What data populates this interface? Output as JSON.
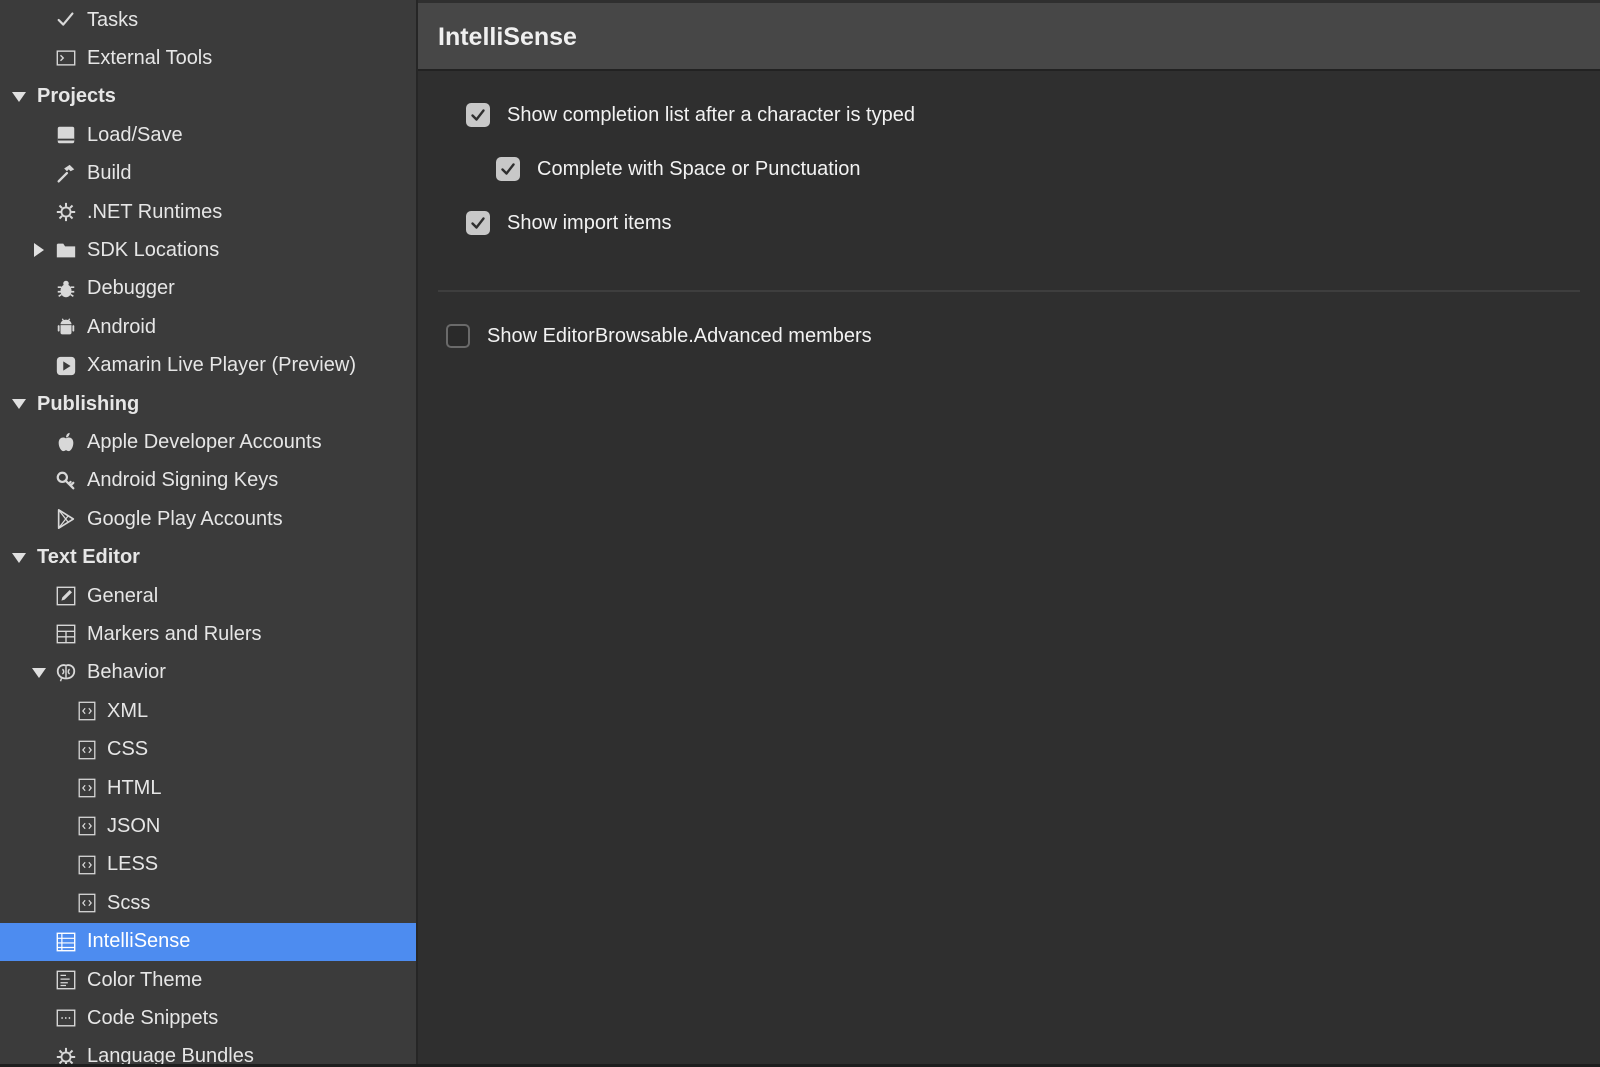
{
  "sidebar": {
    "items": [
      {
        "label": "Tasks",
        "icon": "checkmark-icon",
        "kind": "item"
      },
      {
        "label": "External Tools",
        "icon": "terminal-icon",
        "kind": "item"
      },
      {
        "label": "Projects",
        "kind": "category",
        "expanded": true
      },
      {
        "label": "Load/Save",
        "icon": "disk-icon",
        "kind": "item"
      },
      {
        "label": "Build",
        "icon": "hammer-icon",
        "kind": "item"
      },
      {
        "label": ".NET Runtimes",
        "icon": "gear-icon",
        "kind": "item"
      },
      {
        "label": "SDK Locations",
        "icon": "folder-icon",
        "kind": "item",
        "expandable": true,
        "expanded": false
      },
      {
        "label": "Debugger",
        "icon": "bug-icon",
        "kind": "item"
      },
      {
        "label": "Android",
        "icon": "android-icon",
        "kind": "item"
      },
      {
        "label": "Xamarin Live Player (Preview)",
        "icon": "play-icon",
        "kind": "item"
      },
      {
        "label": "Publishing",
        "kind": "category",
        "expanded": true
      },
      {
        "label": "Apple Developer Accounts",
        "icon": "apple-icon",
        "kind": "item"
      },
      {
        "label": "Android Signing Keys",
        "icon": "key-icon",
        "kind": "item"
      },
      {
        "label": "Google Play Accounts",
        "icon": "google-play-icon",
        "kind": "item"
      },
      {
        "label": "Text Editor",
        "kind": "category",
        "expanded": true
      },
      {
        "label": "General",
        "icon": "edit-icon",
        "kind": "item"
      },
      {
        "label": "Markers and Rulers",
        "icon": "ruler-grid-icon",
        "kind": "item"
      },
      {
        "label": "Behavior",
        "icon": "brain-icon",
        "kind": "item",
        "expandable": true,
        "expanded": true
      },
      {
        "label": "XML",
        "icon": "code-file-icon",
        "kind": "subitem"
      },
      {
        "label": "CSS",
        "icon": "code-file-icon",
        "kind": "subitem"
      },
      {
        "label": "HTML",
        "icon": "code-file-icon",
        "kind": "subitem"
      },
      {
        "label": "JSON",
        "icon": "code-file-icon",
        "kind": "subitem"
      },
      {
        "label": "LESS",
        "icon": "code-file-icon",
        "kind": "subitem"
      },
      {
        "label": "Scss",
        "icon": "code-file-icon",
        "kind": "subitem"
      },
      {
        "label": "IntelliSense",
        "icon": "list-icon",
        "kind": "item",
        "selected": true
      },
      {
        "label": "Color Theme",
        "icon": "document-icon",
        "kind": "item"
      },
      {
        "label": "Code Snippets",
        "icon": "snippet-icon",
        "kind": "item"
      },
      {
        "label": "Language Bundles",
        "icon": "gear-icon",
        "kind": "item"
      }
    ]
  },
  "main": {
    "title": "IntelliSense",
    "options": [
      {
        "label": "Show completion list after a character is typed",
        "checked": true
      },
      {
        "label": "Complete with Space or Punctuation",
        "checked": true
      },
      {
        "label": "Show import items",
        "checked": true
      },
      {
        "label": "Show EditorBrowsable.Advanced members",
        "checked": false
      }
    ]
  },
  "colors": {
    "accent": "#4d8cf0",
    "sidebar_bg": "#3b3b3b",
    "panel_bg": "#2f2f2f",
    "header_bg": "#474747"
  }
}
